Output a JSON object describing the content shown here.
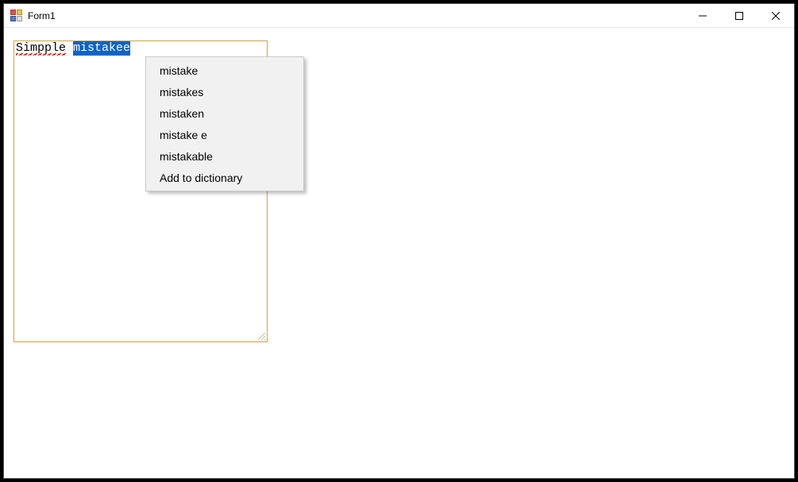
{
  "window": {
    "title": "Form1"
  },
  "editor": {
    "word1": "Simpple",
    "space": " ",
    "word2": "mistakee"
  },
  "contextMenu": {
    "items": [
      {
        "label": "mistake"
      },
      {
        "label": "mistakes"
      },
      {
        "label": "mistaken"
      },
      {
        "label": "mistake e"
      },
      {
        "label": "mistakable"
      },
      {
        "label": "Add to dictionary"
      }
    ]
  }
}
